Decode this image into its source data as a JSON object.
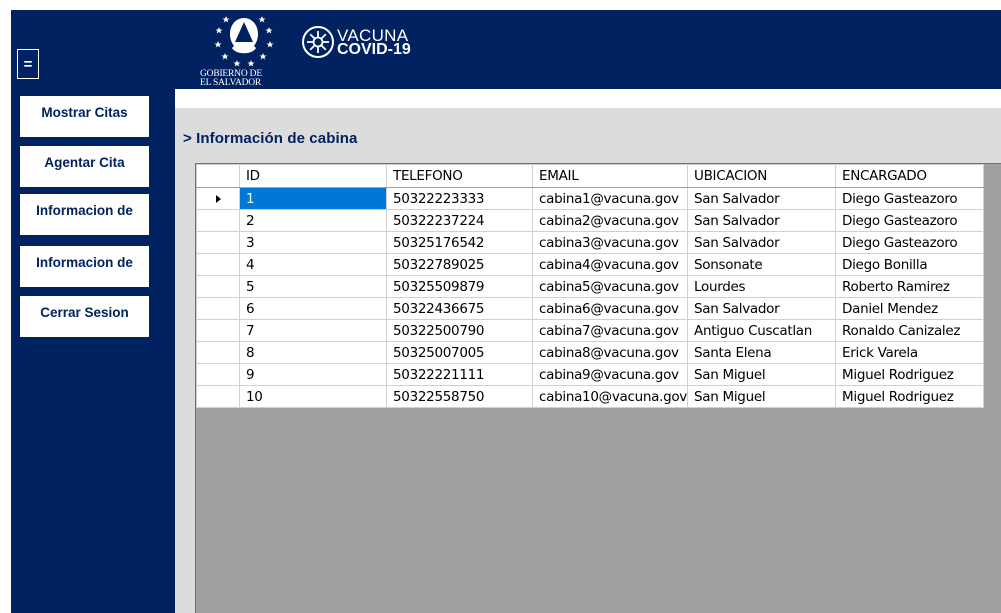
{
  "header": {
    "menu_label": "=",
    "gov_line1": "GOBIERNO DE",
    "gov_line2": "EL SALVADOR",
    "vacuna_line1": "VACUNA",
    "vacuna_line2": "COVID-19"
  },
  "sidebar": {
    "items": [
      {
        "label": "Mostrar Citas"
      },
      {
        "label": "Agentar Cita"
      },
      {
        "label": "Informacion de"
      },
      {
        "label": "Informacion de"
      },
      {
        "label": "Cerrar Sesion"
      }
    ]
  },
  "main": {
    "title": "> Información de cabina",
    "table": {
      "columns": [
        "ID",
        "TELEFONO",
        "EMAIL",
        "UBICACION",
        "ENCARGADO"
      ],
      "rows": [
        [
          "1",
          "50322223333",
          "cabina1@vacuna.gov",
          "San Salvador",
          "Diego Gasteazoro"
        ],
        [
          "2",
          "50322237224",
          "cabina2@vacuna.gov",
          "San Salvador",
          "Diego Gasteazoro"
        ],
        [
          "3",
          "50325176542",
          "cabina3@vacuna.gov",
          "San Salvador",
          "Diego Gasteazoro"
        ],
        [
          "4",
          "50322789025",
          "cabina4@vacuna.gov",
          "Sonsonate",
          "Diego Bonilla"
        ],
        [
          "5",
          "50325509879",
          "cabina5@vacuna.gov",
          "Lourdes",
          "Roberto Ramirez"
        ],
        [
          "6",
          "50322436675",
          "cabina6@vacuna.gov",
          "San Salvador",
          "Daniel Mendez"
        ],
        [
          "7",
          "50322500790",
          "cabina7@vacuna.gov",
          "Antiguo Cuscatlan",
          "Ronaldo Canizalez"
        ],
        [
          "8",
          "50325007005",
          "cabina8@vacuna.gov",
          "Santa Elena",
          "Erick Varela"
        ],
        [
          "9",
          "50322221111",
          "cabina9@vacuna.gov",
          "San Miguel",
          "Miguel Rodriguez"
        ],
        [
          "10",
          "50322558750",
          "cabina10@vacuna.gov",
          "San Miguel",
          "Miguel Rodriguez"
        ]
      ],
      "selected_row": 0
    }
  },
  "colors": {
    "navy": "#012260",
    "panel_gray": "#dcdcdc",
    "grid_background": "#a0a0a0",
    "selection": "#0078d7"
  }
}
